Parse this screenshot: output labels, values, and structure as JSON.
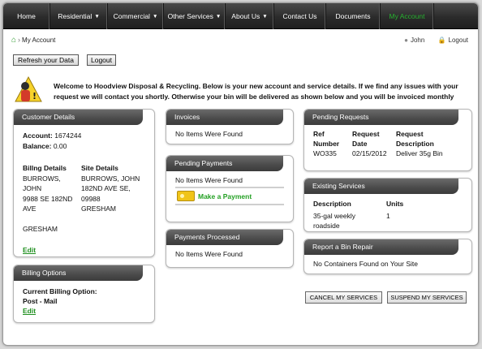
{
  "nav": {
    "items": [
      {
        "label": "Home",
        "dropdown": false
      },
      {
        "label": "Residential",
        "dropdown": true
      },
      {
        "label": "Commercial",
        "dropdown": true
      },
      {
        "label": "Other Services",
        "dropdown": true
      },
      {
        "label": "About Us",
        "dropdown": true
      },
      {
        "label": "Contact Us",
        "dropdown": false
      },
      {
        "label": "Documents",
        "dropdown": false
      },
      {
        "label": "My Account",
        "dropdown": false,
        "active": true
      }
    ],
    "dropdown_glyph": "▼"
  },
  "breadcrumb": {
    "home_glyph": "⌂",
    "separator": "›",
    "current": "My Account"
  },
  "userbar": {
    "user_glyph": "●",
    "user_name": "John",
    "lock_glyph": "🔒",
    "logout_label": "Logout"
  },
  "actions": {
    "refresh_label": "Refresh your Data",
    "logout_label": "Logout"
  },
  "welcome": {
    "text": "Welcome to Hoodview Disposal & Recycling. Below is your new account and service details. If we find any issues with your request we will contact you shortly. Otherwise your bin will be delivered as shown below and you will be invoiced monthly"
  },
  "customer": {
    "title": "Customer Details",
    "account_label": "Account:",
    "account_value": "1674244",
    "balance_label": "Balance:",
    "balance_value": "0.00",
    "billing_header": "Billng Details",
    "billing_lines": [
      "BURROWS, JOHN",
      "9988 SE 182ND",
      "AVE",
      "",
      "GRESHAM"
    ],
    "site_header": "Site Details",
    "site_lines": [
      "BURROWS, JOHN",
      "182ND AVE SE,",
      "09988",
      "GRESHAM"
    ],
    "edit_label": "Edit"
  },
  "billing_options": {
    "title": "Billing Options",
    "label": "Current Billing Option:",
    "value": "Post - Mail",
    "edit_label": "Edit"
  },
  "invoices": {
    "title": "Invoices",
    "empty": "No Items Were Found"
  },
  "pending_payments": {
    "title": "Pending Payments",
    "empty": "No Items Were Found",
    "pay_label": "Make a Payment"
  },
  "payments_processed": {
    "title": "Payments Processed",
    "empty": "No Items Were Found"
  },
  "pending_requests": {
    "title": "Pending Requests",
    "headers": [
      "Ref\nNumber",
      "Request\nDate",
      "Request\nDescription"
    ],
    "headers_line1": [
      "Ref",
      "Request",
      "Request"
    ],
    "headers_line2": [
      "Number",
      "Date",
      "Description"
    ],
    "row": [
      "WO335",
      "02/15/2012",
      "Deliver 35g Bin"
    ]
  },
  "existing_services": {
    "title": "Existing Services",
    "headers": [
      "Description",
      "Units"
    ],
    "row": [
      "35-gal weekly roadside",
      "1"
    ]
  },
  "bin_repair": {
    "title": "Report a Bin Repair",
    "empty": "No Containers Found on Your Site"
  },
  "bottom_buttons": {
    "cancel_label": "CANCEL MY SERVICES",
    "suspend_label": "SUSPEND MY SERVICES"
  },
  "colors": {
    "nav_active": "#27b230",
    "link_green": "#1e8f1e",
    "panel_header": "#4a4a4a"
  }
}
